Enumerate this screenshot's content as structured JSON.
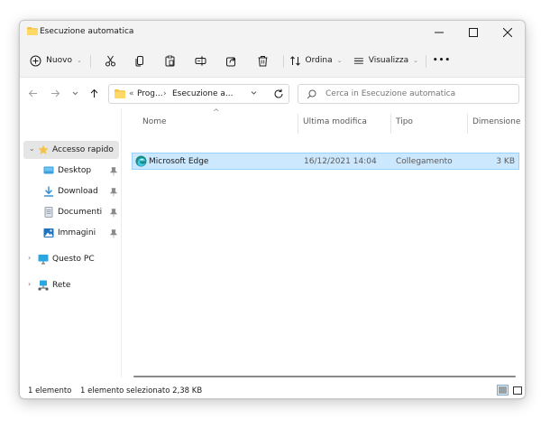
{
  "window": {
    "title": "Esecuzione automatica"
  },
  "toolbar": {
    "new_label": "Nuovo",
    "sort_label": "Ordina",
    "view_label": "Visualizza",
    "more_label": "•••"
  },
  "address": {
    "overflow": "«",
    "crumb1": "Prog...",
    "separator": "›",
    "crumb2": "Esecuzione a..."
  },
  "search": {
    "placeholder": "Cerca in Esecuzione automatica"
  },
  "sidebar": {
    "items": [
      {
        "label": "Accesso rapido",
        "icon": "star-icon",
        "expander": "⌄",
        "selected": true
      },
      {
        "label": "Desktop",
        "icon": "desktop-icon",
        "pinned": true
      },
      {
        "label": "Download",
        "icon": "download-icon",
        "pinned": true
      },
      {
        "label": "Documenti",
        "icon": "documents-icon",
        "pinned": true
      },
      {
        "label": "Immagini",
        "icon": "images-icon",
        "pinned": true
      },
      {
        "label": "Questo PC",
        "icon": "pc-icon",
        "expander": "›"
      },
      {
        "label": "Rete",
        "icon": "network-icon",
        "expander": "›"
      }
    ]
  },
  "file_list": {
    "columns": [
      "Nome",
      "Ultima modifica",
      "Tipo",
      "Dimensione"
    ],
    "sort_indicator": "^",
    "rows": [
      {
        "name": "Microsoft Edge",
        "modified": "16/12/2021 14:04",
        "type": "Collegamento",
        "size": "3 KB",
        "icon": "edge-icon"
      }
    ]
  },
  "status": {
    "count": "1 elemento",
    "selection": "1 elemento selezionato  2,38 KB"
  },
  "colors": {
    "accent": "#0067c0",
    "selection_bg": "#cce8ff",
    "selection_border": "#99d1ff",
    "folder": "#f5c342"
  }
}
